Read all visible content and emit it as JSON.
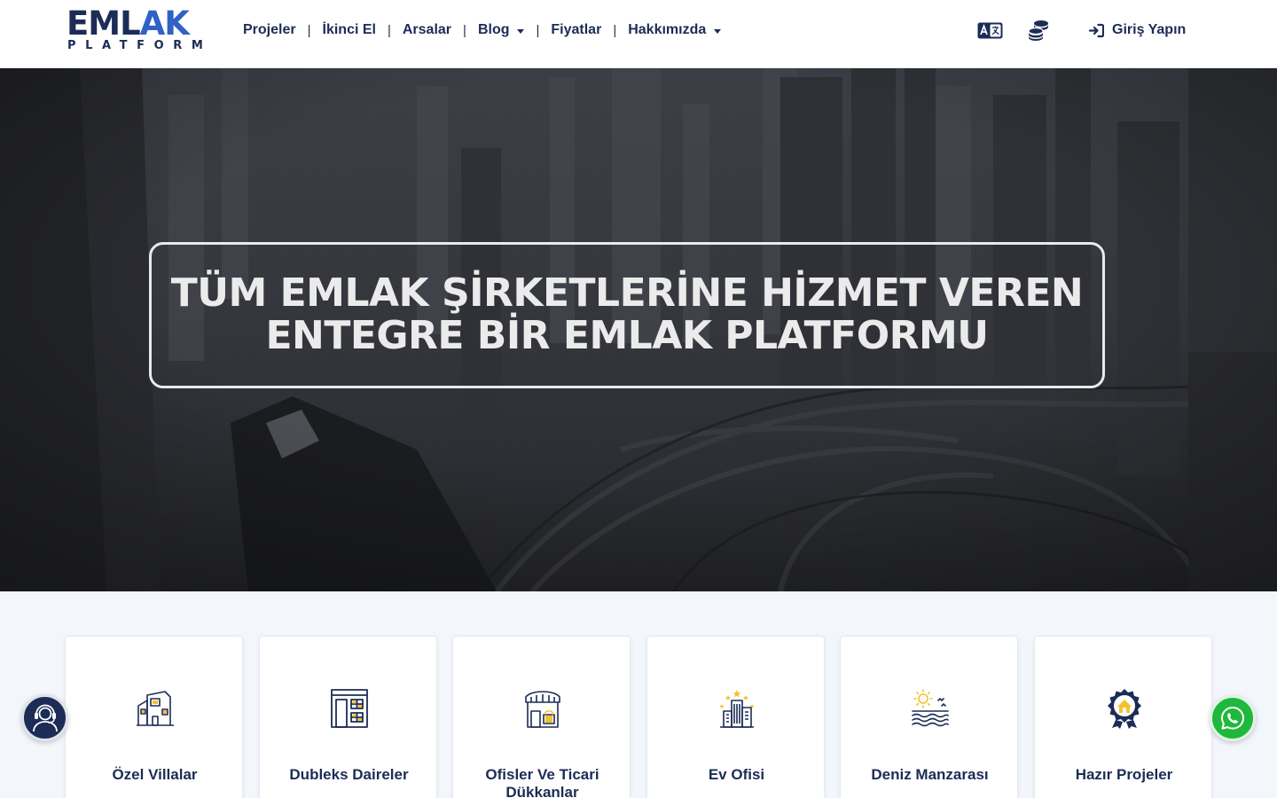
{
  "brand": {
    "logo_line1_a": "EML",
    "logo_line1_b": "AK",
    "logo_line2": "PLATFORM"
  },
  "nav": {
    "items": [
      {
        "label": "Projeler",
        "dropdown": false
      },
      {
        "label": "İkinci El",
        "dropdown": false
      },
      {
        "label": "Arsalar",
        "dropdown": false
      },
      {
        "label": "Blog",
        "dropdown": true
      },
      {
        "label": "Fiyatlar",
        "dropdown": false
      },
      {
        "label": "Hakkımızda",
        "dropdown": true
      }
    ],
    "separator": "|"
  },
  "header_actions": {
    "language_icon": "translate-icon",
    "currency_icon": "coins-icon",
    "login_icon": "sign-in-icon",
    "login_label": "Giriş Yapın"
  },
  "hero": {
    "title_line1": "TÜM EMLAK ŞİRKETLERİNE HİZMET VEREN",
    "title_line2": "ENTEGRE BİR EMLAK PLATFORMU"
  },
  "categories": [
    {
      "label": "Özel Villalar",
      "icon": "villa-icon"
    },
    {
      "label": "Dubleks Daireler",
      "icon": "duplex-building-icon"
    },
    {
      "label": "Ofisler Ve Ticari Dükkanlar",
      "icon": "shop-icon"
    },
    {
      "label": "Ev Ofisi",
      "icon": "city-buildings-icon"
    },
    {
      "label": "Deniz Manzarası",
      "icon": "sea-view-icon"
    },
    {
      "label": "Hazır Projeler",
      "icon": "badge-home-icon"
    }
  ],
  "floating": {
    "support_icon": "customer-support-icon",
    "whatsapp_icon": "whatsapp-icon"
  },
  "colors": {
    "navy": "#1c2c56",
    "accent_blue": "#2f62c4",
    "icon_gold": "#f2c22e",
    "whatsapp_green": "#1fb83d",
    "page_bg": "#f3f6fb"
  }
}
